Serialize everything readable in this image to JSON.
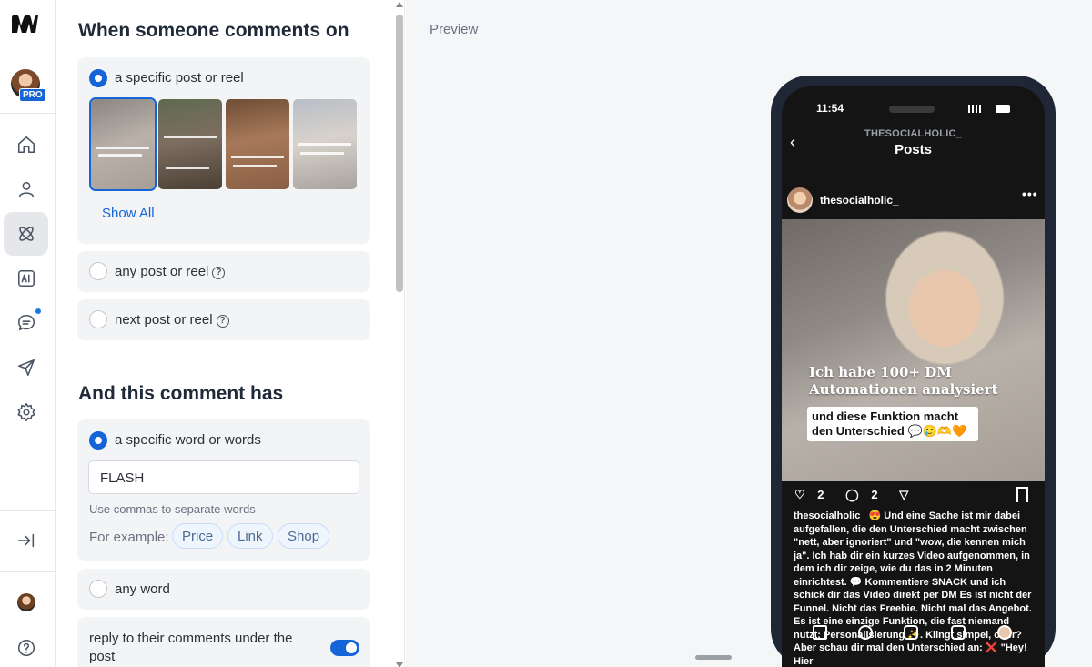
{
  "rail": {
    "badge": "PRO"
  },
  "panel": {
    "trigger_title": "When someone comments on",
    "option_specific_post": "a specific post or reel",
    "show_all": "Show All",
    "option_any_post": "any post or reel",
    "option_next_post": "next post or reel",
    "condition_title": "And this comment has",
    "option_specific_word": "a specific word or words",
    "keyword_value": "FLASH",
    "keyword_hint": "Use commas to separate words",
    "example_label": "For example:",
    "example_chips": [
      "Price",
      "Link",
      "Shop"
    ],
    "option_any_word": "any word",
    "reply_toggle_label": "reply to their comments under the post",
    "reply_toggle_on": true
  },
  "preview": {
    "label": "Preview",
    "status_time": "11:54",
    "account_small": "THESOCIALHOLIC_",
    "screen_title": "Posts",
    "post_username": "thesocialholic_",
    "headline_line1": "Ich habe 100+ DM",
    "headline_line2": "Automationen analysiert",
    "subhead_line1": "und diese Funktion macht",
    "subhead_line2": "den Unterschied 💬🥲🫶🧡",
    "likes": "2",
    "comments": "2",
    "caption": "thesocialholic_ 😍 Und eine Sache ist mir dabei aufgefallen, die den Unterschied macht zwischen \"nett, aber ignoriert\" und \"wow, die kennen mich ja\". Ich hab dir ein kurzes Video aufgenommen, in dem ich dir zeige, wie du das in 2 Minuten einrichtest. 💬 Kommentiere SNACK und ich schick dir das Video direkt per DM Es ist nicht der Funnel. Nicht das Freebie. Nicht mal das Angebot. Es ist eine einzige Funktion, die fast niemand nutzt: Personalisierung ✨. Klingt simpel, oder? Aber schau dir mal den Unterschied an: ❌ \"Hey! Hier"
  },
  "colors": {
    "accent": "#1565d8",
    "card_bg": "#f3f4f6",
    "phone_frame": "#1f2737"
  }
}
